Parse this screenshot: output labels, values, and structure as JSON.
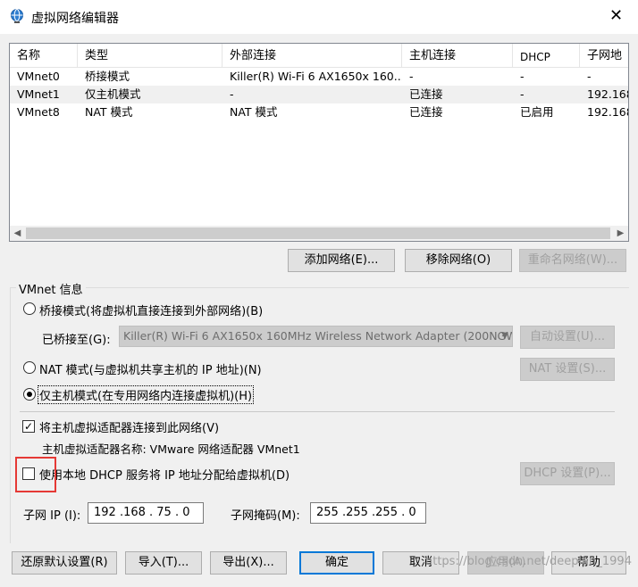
{
  "window": {
    "title": "虚拟网络编辑器",
    "close_icon": "✕"
  },
  "list": {
    "columns": [
      "名称",
      "类型",
      "外部连接",
      "主机连接",
      "DHCP",
      "子网地"
    ],
    "rows": [
      [
        "VMnet0",
        "桥接模式",
        "Killer(R) Wi-Fi 6 AX1650x 160...",
        "-",
        "-",
        "-"
      ],
      [
        "VMnet1",
        "仅主机模式",
        "-",
        "已连接",
        "-",
        "192.168"
      ],
      [
        "VMnet8",
        "NAT 模式",
        "NAT 模式",
        "已连接",
        "已启用",
        "192.168"
      ]
    ],
    "selected_row": 1
  },
  "network_buttons": {
    "add": "添加网络(E)...",
    "remove": "移除网络(O)",
    "rename": "重命名网络(W)..."
  },
  "vmnet_info": {
    "label": "VMnet 信息",
    "bridged_label": "桥接模式(将虚拟机直接连接到外部网络)(B)",
    "bridged_to_label": "已桥接至(G):",
    "bridged_to_value": "Killer(R) Wi-Fi 6 AX1650x 160MHz Wireless Network Adapter (200NGW)",
    "auto_settings": "自动设置(U)...",
    "nat_label": "NAT 模式(与虚拟机共享主机的 IP 地址)(N)",
    "nat_settings": "NAT 设置(S)...",
    "hostonly_label": "仅主机模式(在专用网络内连接虚拟机)(H)",
    "selected_mode": "hostonly",
    "connect_adapter_label": "将主机虚拟适配器连接到此网络(V)",
    "connect_adapter_checked": true,
    "adapter_name_text": "主机虚拟适配器名称: VMware 网络适配器 VMnet1",
    "dhcp_label": "使用本地 DHCP 服务将 IP 地址分配给虚拟机(D)",
    "dhcp_checked": false,
    "dhcp_settings": "DHCP 设置(P)...",
    "subnet_ip_label": "子网 IP (I):",
    "subnet_ip_value": "192 .168 . 75  .  0",
    "subnet_mask_label": "子网掩码(M):",
    "subnet_mask_value": "255 .255 .255 .  0"
  },
  "footer": {
    "restore_defaults": "还原默认设置(R)",
    "import": "导入(T)...",
    "export": "导出(X)...",
    "ok": "确定",
    "cancel": "取消",
    "apply": "应用(A)",
    "help": "帮助"
  },
  "watermark": "https://blog.csdn.net/deeplan_1994",
  "colors": {
    "highlight": "#e53935",
    "default_button_border": "#0078d7"
  }
}
